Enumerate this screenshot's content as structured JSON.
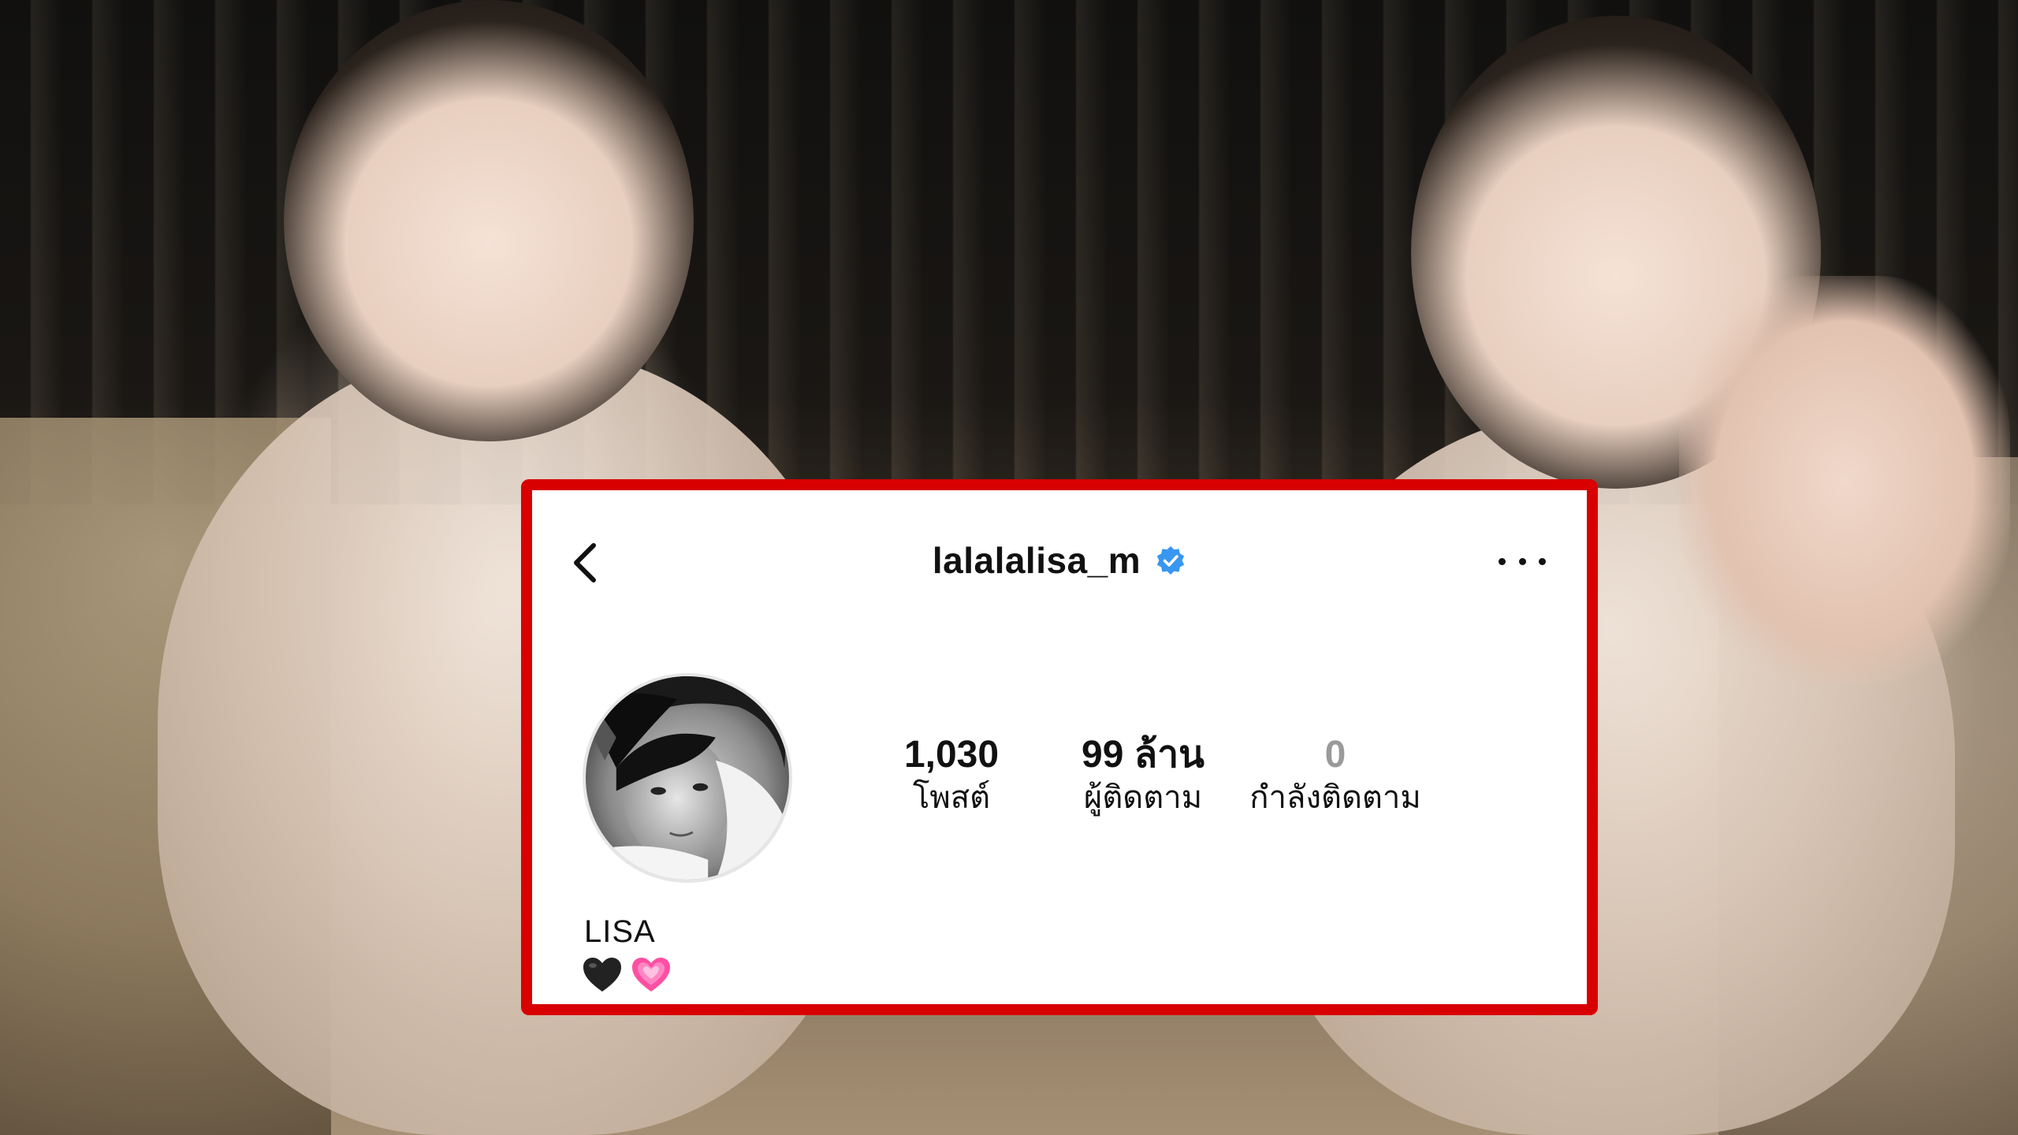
{
  "profile": {
    "username": "lalalalisa_m",
    "display_name": "LISA",
    "bio_emojis": [
      "black-heart",
      "pink-heart"
    ],
    "verified": true
  },
  "stats": {
    "posts_value": "1,030",
    "posts_label": "โพสต์",
    "followers_value": "99 ล้าน",
    "followers_label": "ผู้ติดตาม",
    "following_value": "0",
    "following_label": "กำลังติดตาม"
  },
  "icons": {
    "back": "chevron-left-icon",
    "verified": "verified-badge-icon",
    "more": "more-horizontal-icon"
  },
  "colors": {
    "frame_border": "#d80000",
    "verified_blue": "#3897f0",
    "muted_text": "#9a9a9a"
  }
}
